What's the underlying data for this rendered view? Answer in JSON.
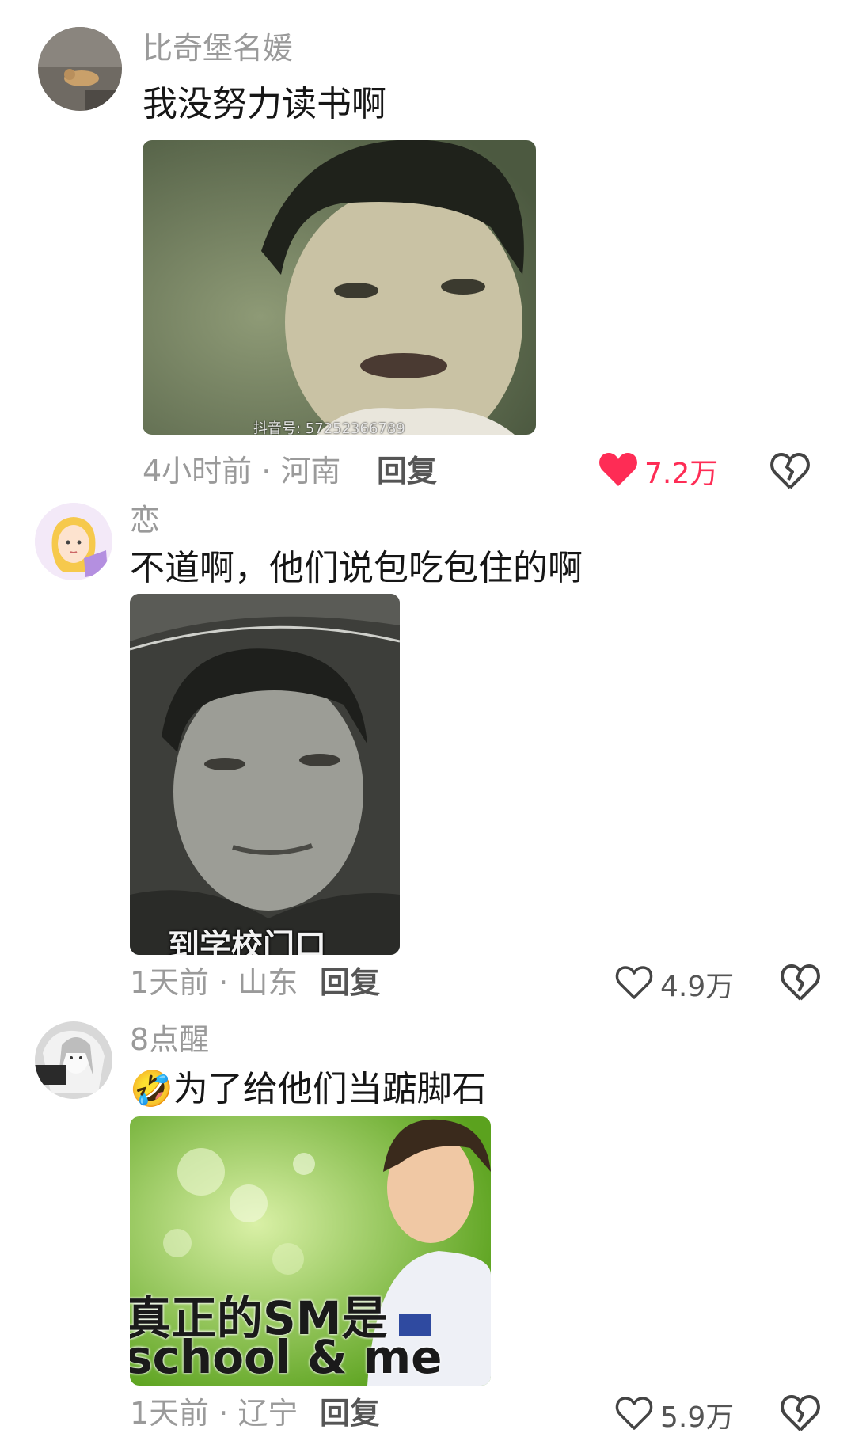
{
  "comments": [
    {
      "username": "比奇堡名媛",
      "text": "我没努力读书啊",
      "watermark": "抖音号: 57252366789",
      "time": "4小时前 · 河南",
      "reply": "回复",
      "likes": "7.2万",
      "liked": true,
      "icons": {
        "like": "heart-filled-icon",
        "dislike": "broken-heart-icon"
      },
      "colors": {
        "like": "#fe2c55"
      }
    },
    {
      "username": "恋",
      "text": "不道啊，他们说包吃包住的啊",
      "caption": "到学校门口",
      "time": "1天前 · 山东",
      "reply": "回复",
      "likes": "4.9万",
      "liked": false,
      "icons": {
        "like": "heart-outline-icon",
        "dislike": "broken-heart-icon"
      }
    },
    {
      "username": "8点醒",
      "emoji": "🤣",
      "text": "为了给他们当踮脚石",
      "caption_line1": "真正的SM是",
      "caption_line2": "school & me",
      "time": "1天前 · 辽宁",
      "reply": "回复",
      "likes": "5.9万",
      "liked": false,
      "icons": {
        "like": "heart-outline-icon",
        "dislike": "broken-heart-icon"
      }
    }
  ]
}
